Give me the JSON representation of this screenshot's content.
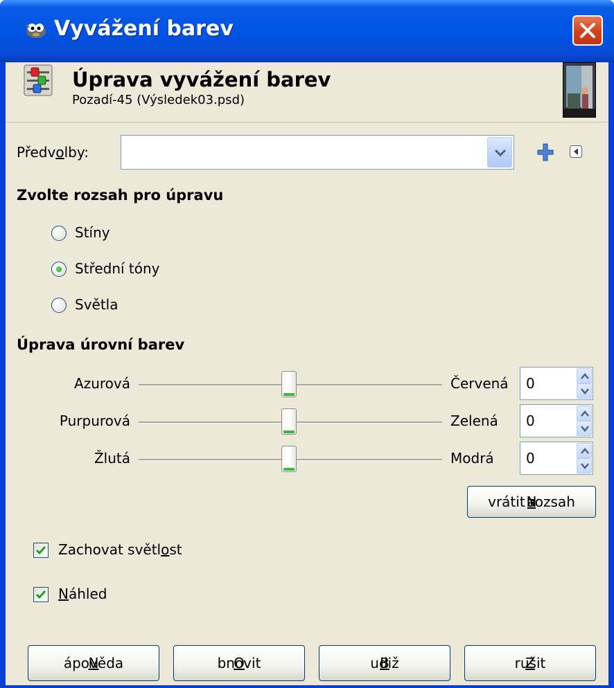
{
  "window": {
    "title": "Vyvážení barev",
    "close_icon": "close-icon",
    "app_icon": "gimp-wilber-icon"
  },
  "header": {
    "title": "Úprava vyvážení barev",
    "subtitle": "Pozadí-45 (Výsledek03.psd)",
    "tool_icon": "color-balance-tool-icon",
    "thumbnail_icon": "image-thumbnail"
  },
  "presets": {
    "label_pre": "Předv",
    "label_key": "o",
    "label_post": "lby:",
    "value": "",
    "add_icon": "plus-icon",
    "menu_icon": "menu-arrow-icon"
  },
  "range": {
    "heading": "Zvolte rozsah pro úpravu",
    "options": [
      {
        "label": "Stíny",
        "selected": false
      },
      {
        "label": "Střední tóny",
        "selected": true
      },
      {
        "label": "Světla",
        "selected": false
      }
    ]
  },
  "levels": {
    "heading": "Úprava úrovní barev",
    "sliders": [
      {
        "left": "Azurová",
        "right": "Červená",
        "value": "0"
      },
      {
        "left": "Purpurová",
        "right": "Zelená",
        "value": "0"
      },
      {
        "left": "Žlutá",
        "right": "Modrá",
        "value": "0"
      }
    ],
    "reset_pre": "N",
    "reset_key": "a",
    "reset_post": "vrátit rozsah"
  },
  "options": {
    "preserve_pre": "Zachovat světl",
    "preserve_key": "o",
    "preserve_post": "st",
    "preserve_checked": true,
    "preview_key": "N",
    "preview_post": "áhled",
    "preview_checked": true
  },
  "buttons": {
    "help_key": "N",
    "help_post": "ápověda",
    "reset_key": "O",
    "reset_post": "bnovit",
    "ok_key": "B",
    "ok_post": "udiž",
    "cancel_key": "Z",
    "cancel_post": "rušit"
  },
  "colors": {
    "titlebar": "#0054e3",
    "dialog_bg": "#ece9d8",
    "accent_green": "#2fa82f"
  }
}
